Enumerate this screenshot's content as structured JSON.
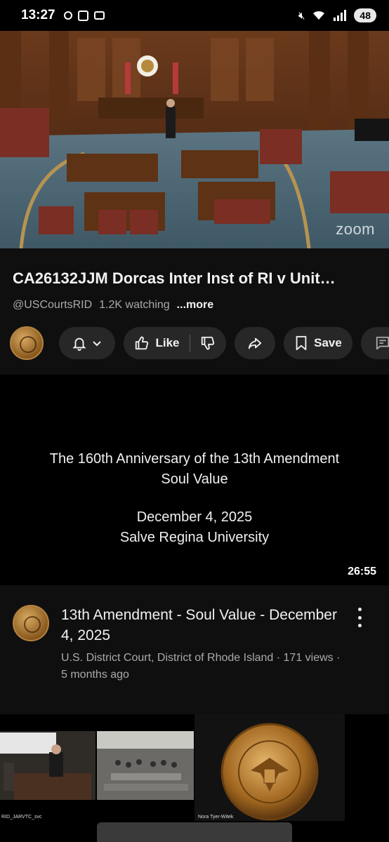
{
  "status_bar": {
    "time": "13:27",
    "battery": "48",
    "icons": [
      "teams-icon",
      "instagram-icon",
      "mail-icon",
      "mute-icon",
      "wifi-icon",
      "signal-icon"
    ]
  },
  "player": {
    "watermark": "zoom"
  },
  "video": {
    "title": "CA26132JJM Dorcas Inter Inst of RI v Unit…",
    "channel": "@USCourtsRID",
    "watching": "1.2K watching",
    "more": "...more"
  },
  "actions": {
    "like_label": "Like",
    "save_label": "Save"
  },
  "next_thumbnail": {
    "lines": [
      "The 160th Anniversary of the 13th Amendment",
      "Soul Value",
      "December 4, 2025",
      "Salve Regina University"
    ],
    "duration": "26:55"
  },
  "next_video": {
    "title": "13th Amendment - Soul Value - December 4, 2025",
    "channel": "U.S. District Court, District of Rhode Island",
    "views": "171 views",
    "age": "5 months ago",
    "subline": "U.S. District Court, District of Rhode Island · 171 views · 5 months ago"
  },
  "third_thumbnail": {
    "caption_left": "RID_JARVTC_svc",
    "caption_right": "Nora Tyer-Witek"
  },
  "colors": {
    "background": "#0f0f0f",
    "pill": "#272727",
    "muted_text": "#aaaaaa",
    "seal_gold": "#b48240"
  }
}
